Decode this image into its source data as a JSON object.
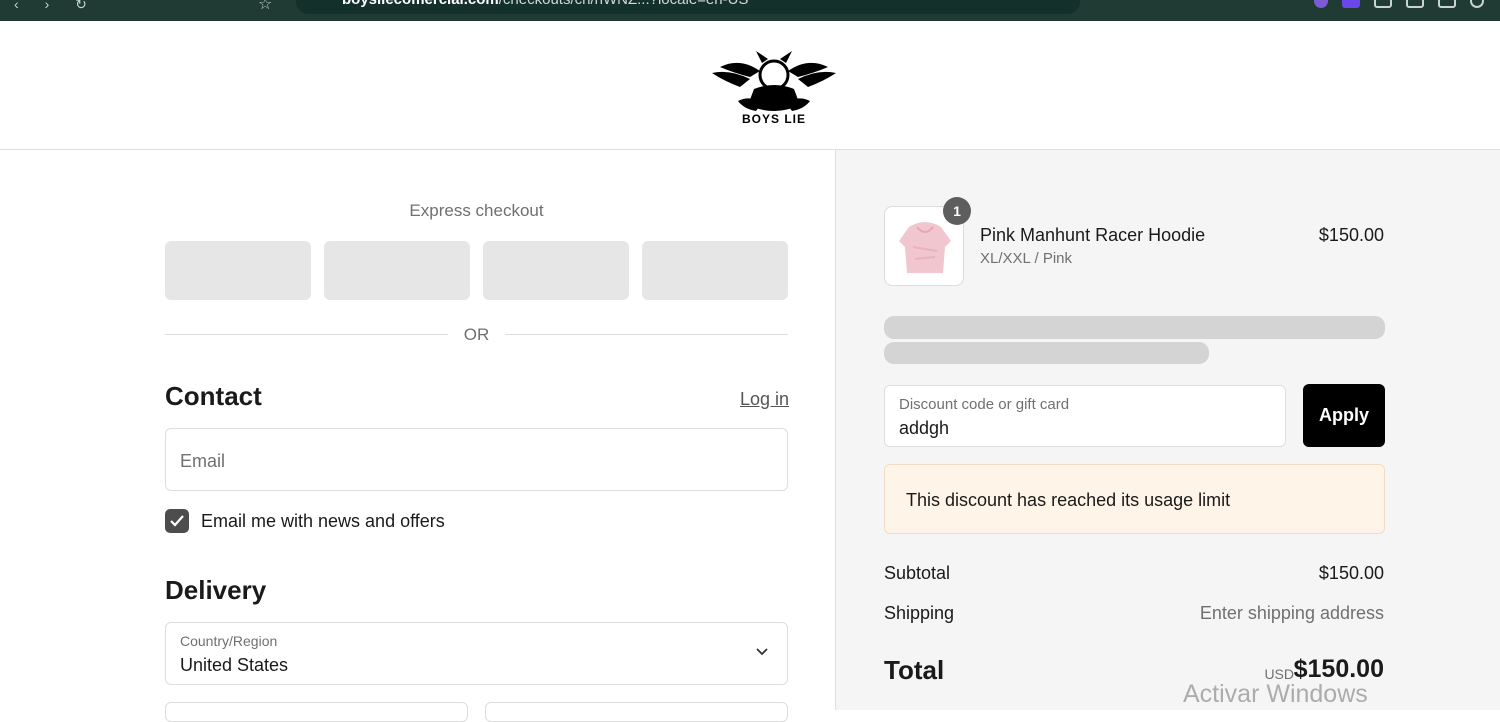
{
  "browser": {
    "url_host": "boysliecomercial.com",
    "url_path": "/checkouts/cn/hWNZ...?locale=en-US"
  },
  "header": {
    "logo_text": "BOYS LIE"
  },
  "checkout": {
    "express_label": "Express checkout",
    "or_label": "OR",
    "contact": {
      "title": "Contact",
      "login_label": "Log in",
      "email_placeholder": "Email",
      "newsletter_label": "Email me with news and offers",
      "newsletter_checked": true
    },
    "delivery": {
      "title": "Delivery",
      "country_label": "Country/Region",
      "country_value": "United States"
    }
  },
  "summary": {
    "item": {
      "quantity": "1",
      "name": "Pink Manhunt Racer Hoodie",
      "variant": "XL/XXL / Pink",
      "price": "$150.00"
    },
    "discount": {
      "label": "Discount code or gift card",
      "value": "addgh",
      "apply_label": "Apply",
      "error": "This discount has reached its usage limit"
    },
    "subtotal_label": "Subtotal",
    "subtotal_value": "$150.00",
    "shipping_label": "Shipping",
    "shipping_value": "Enter shipping address",
    "total_label": "Total",
    "total_currency": "USD",
    "total_value": "$150.00"
  },
  "os": {
    "watermark": "Activar Windows"
  },
  "colors": {
    "accent_button": "#000000",
    "notice_bg": "#fff4e8",
    "summary_bg": "#f5f5f5"
  }
}
